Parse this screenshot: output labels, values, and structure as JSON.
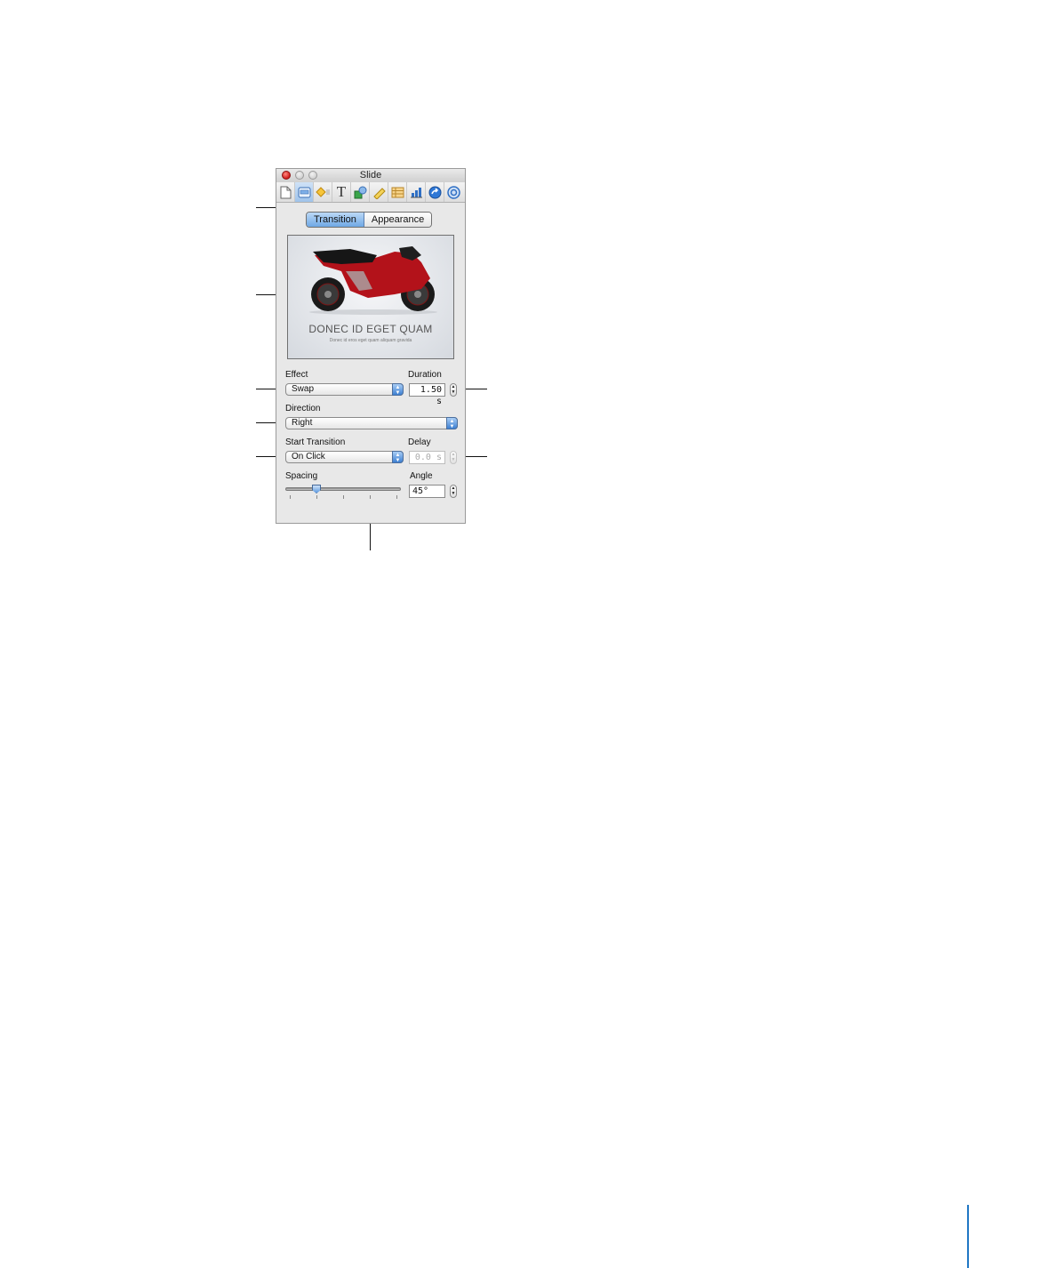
{
  "window": {
    "title": "Slide",
    "traffic_lights": [
      "close",
      "minimize",
      "zoom"
    ]
  },
  "toolbar": {
    "items": [
      {
        "name": "document-inspector",
        "icon": "document-icon",
        "glyph": "🗋"
      },
      {
        "name": "slide-inspector",
        "icon": "slide-icon",
        "glyph": "▭",
        "active": true
      },
      {
        "name": "build-inspector",
        "icon": "build-diamond-icon",
        "glyph": "◆"
      },
      {
        "name": "text-inspector",
        "icon": "text-T-icon",
        "glyph": "T"
      },
      {
        "name": "graphic-inspector",
        "icon": "shape-icon",
        "glyph": "◩"
      },
      {
        "name": "metrics-inspector",
        "icon": "ruler-icon",
        "glyph": "📏"
      },
      {
        "name": "table-inspector",
        "icon": "table-icon",
        "glyph": "▤"
      },
      {
        "name": "chart-inspector",
        "icon": "chart-icon",
        "glyph": "▮"
      },
      {
        "name": "hyperlink-inspector",
        "icon": "hyperlink-arrow-icon",
        "glyph": "➜"
      },
      {
        "name": "quicktime-inspector",
        "icon": "quicktime-icon",
        "glyph": "◎"
      }
    ]
  },
  "tabs": [
    {
      "label": "Transition",
      "active": true
    },
    {
      "label": "Appearance",
      "active": false
    }
  ],
  "preview": {
    "title": "DONEC ID EGET QUAM",
    "subtitle": "Donec id eros eget quam aliquam gravida"
  },
  "effect": {
    "label": "Effect",
    "value": "Swap"
  },
  "duration": {
    "label": "Duration",
    "value": "1.50 s"
  },
  "direction": {
    "label": "Direction",
    "value": "Right"
  },
  "start_transition": {
    "label": "Start Transition",
    "value": "On Click"
  },
  "delay": {
    "label": "Delay",
    "value": "0.0 s",
    "disabled": true
  },
  "spacing": {
    "label": "Spacing",
    "value_fraction": 0.25
  },
  "angle": {
    "label": "Angle",
    "value": "45°"
  },
  "colors": {
    "accent": "#6fa8e6",
    "close_button": "#d11a1a",
    "page_rule": "#1f77c4"
  }
}
